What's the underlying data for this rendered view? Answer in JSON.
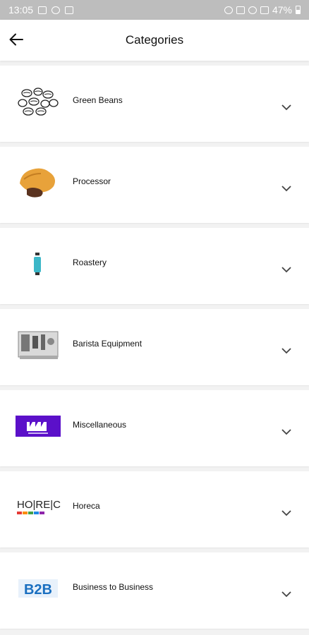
{
  "status_bar": {
    "time": "13:05",
    "battery": "47%"
  },
  "app_bar": {
    "title": "Categories"
  },
  "categories": [
    {
      "label": "Green Beans",
      "icon": "coffee-beans-icon"
    },
    {
      "label": "Processor",
      "icon": "coffee-sack-icon"
    },
    {
      "label": "Roastery",
      "icon": "grinder-icon"
    },
    {
      "label": "Barista Equipment",
      "icon": "espresso-machine-icon"
    },
    {
      "label": "Miscellaneous",
      "icon": "misc-logo-icon",
      "icon_color": "#5b10c9"
    },
    {
      "label": "Horeca",
      "icon": "horeca-logo-icon",
      "icon_text": "HO|RE|CA"
    },
    {
      "label": "Business to Business",
      "icon": "b2b-logo-icon",
      "icon_text": "B2B",
      "icon_color": "#1a6fc0"
    }
  ]
}
